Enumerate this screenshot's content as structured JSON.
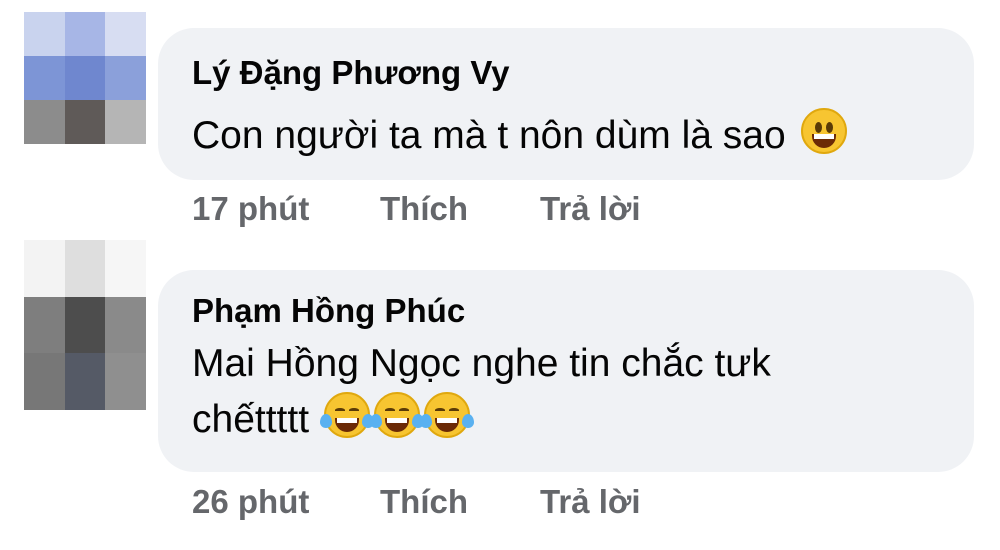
{
  "comments": [
    {
      "author": "Lý Đặng Phương Vy",
      "text": "Con người ta mà t nôn dùm là sao",
      "emoji": "grinning-face-icon",
      "time": "17 phút",
      "like_label": "Thích",
      "reply_label": "Trả lời"
    },
    {
      "author": "Phạm Hồng Phúc",
      "text_line1": "Mai Hồng Ngọc nghe tin chắc tưk",
      "text_line2": "chếttttt",
      "emoji": "face-with-tears-of-joy-icon",
      "emoji_count": 3,
      "time": "26 phút",
      "like_label": "Thích",
      "reply_label": "Trả lời"
    }
  ],
  "colors": {
    "bubble": "#f0f2f5",
    "action_text": "#65676b",
    "text": "#050505"
  }
}
